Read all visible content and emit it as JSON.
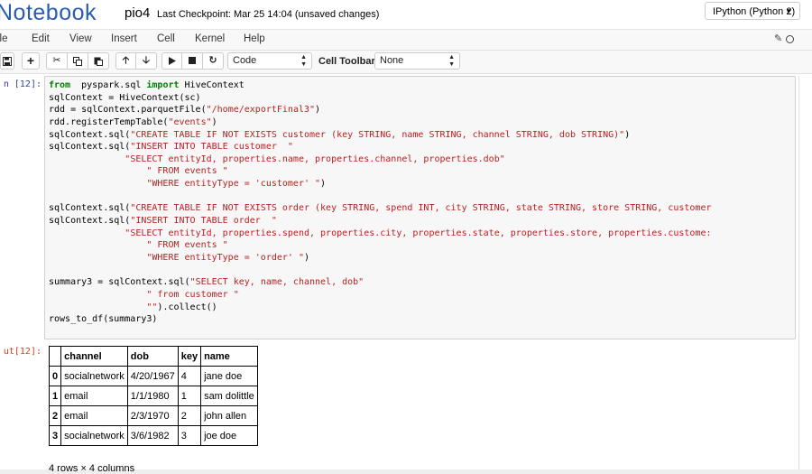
{
  "header": {
    "logo_text": "Notebook",
    "notebook_name": "pio4",
    "checkpoint": "Last Checkpoint: Mar 25 14:04 (unsaved changes)",
    "kernel": "IPython (Python 2)"
  },
  "menu": {
    "file": "ile",
    "edit": "Edit",
    "view": "View",
    "insert": "Insert",
    "cell": "Cell",
    "kernel": "Kernel",
    "help": "Help"
  },
  "toolbar": {
    "cell_type": "Code",
    "cell_toolbar_label": "Cell Toolbar:",
    "cell_toolbar_value": "None"
  },
  "icons": {
    "save": "floppy-disk-icon",
    "insert": "plus-icon",
    "cut": "scissors-icon",
    "copy": "copy-icon",
    "paste": "paste-icon",
    "move_up": "arrow-up-icon",
    "move_down": "arrow-down-icon",
    "run": "play-icon",
    "interrupt": "stop-icon",
    "restart": "refresh-icon",
    "edit_mode": "pencil-icon"
  },
  "cell": {
    "input_prompt": "n [12]:",
    "output_prompt": "ut[12]:",
    "code_lines": [
      [
        [
          "kw",
          "from"
        ],
        [
          "",
          "  pyspark.sql "
        ],
        [
          "kw",
          "import"
        ],
        [
          "",
          " HiveContext"
        ]
      ],
      [
        [
          "",
          "sqlContext = HiveContext(sc)"
        ]
      ],
      [
        [
          "",
          "rdd = sqlContext.parquetFile("
        ],
        [
          "st",
          "\"/home/exportFinal3\""
        ],
        [
          "",
          ")"
        ]
      ],
      [
        [
          "",
          "rdd.registerTempTable("
        ],
        [
          "st",
          "\"events\""
        ],
        [
          "",
          ")"
        ]
      ],
      [
        [
          "",
          "sqlContext.sql("
        ],
        [
          "st",
          "\"CREATE TABLE IF NOT EXISTS customer (key STRING, name STRING, channel STRING, dob STRING)\""
        ],
        [
          "",
          ")"
        ]
      ],
      [
        [
          "",
          "sqlContext.sql("
        ],
        [
          "st",
          "\"INSERT INTO TABLE customer  \""
        ]
      ],
      [
        [
          "",
          "              "
        ],
        [
          "st",
          "\"SELECT entityId, properties.name, properties.channel, properties.dob\""
        ]
      ],
      [
        [
          "",
          "                  "
        ],
        [
          "st",
          "\" FROM events \""
        ]
      ],
      [
        [
          "",
          "                  "
        ],
        [
          "st",
          "\"WHERE entityType = 'customer' \""
        ],
        [
          "",
          ")"
        ]
      ],
      [
        [
          "",
          ""
        ]
      ],
      [
        [
          "",
          "sqlContext.sql("
        ],
        [
          "st",
          "\"CREATE TABLE IF NOT EXISTS order (key STRING, spend INT, city STRING, state STRING, store STRING, customer"
        ]
      ],
      [
        [
          "",
          "sqlContext.sql("
        ],
        [
          "st",
          "\"INSERT INTO TABLE order  \""
        ]
      ],
      [
        [
          "",
          "              "
        ],
        [
          "st",
          "\"SELECT entityId, properties.spend, properties.city, properties.state, properties.store, properties.custome:"
        ]
      ],
      [
        [
          "",
          "                  "
        ],
        [
          "st",
          "\" FROM events \""
        ]
      ],
      [
        [
          "",
          "                  "
        ],
        [
          "st",
          "\"WHERE entityType = 'order' \""
        ],
        [
          "",
          ")"
        ]
      ],
      [
        [
          "",
          ""
        ]
      ],
      [
        [
          "",
          "summary3 = sqlContext.sql("
        ],
        [
          "st",
          "\"SELECT key, name, channel, dob\""
        ]
      ],
      [
        [
          "",
          "                  "
        ],
        [
          "st",
          "\" from customer \""
        ]
      ],
      [
        [
          "",
          "                  "
        ],
        [
          "st",
          "\"\""
        ],
        [
          "",
          ").collect()"
        ]
      ],
      [
        [
          "",
          "rows_to_df(summary3)"
        ]
      ]
    ]
  },
  "output": {
    "columns": [
      "",
      "channel",
      "dob",
      "key",
      "name"
    ],
    "rows": [
      [
        "0",
        "socialnetwork",
        "4/20/1967",
        "4",
        "jane doe"
      ],
      [
        "1",
        "email",
        "1/1/1980",
        "1",
        "sam dolittle"
      ],
      [
        "2",
        "email",
        "2/3/1970",
        "2",
        "john allen"
      ],
      [
        "3",
        "socialnetwork",
        "3/6/1982",
        "3",
        "joe doe"
      ]
    ],
    "summary": "4 rows × 4 columns"
  }
}
